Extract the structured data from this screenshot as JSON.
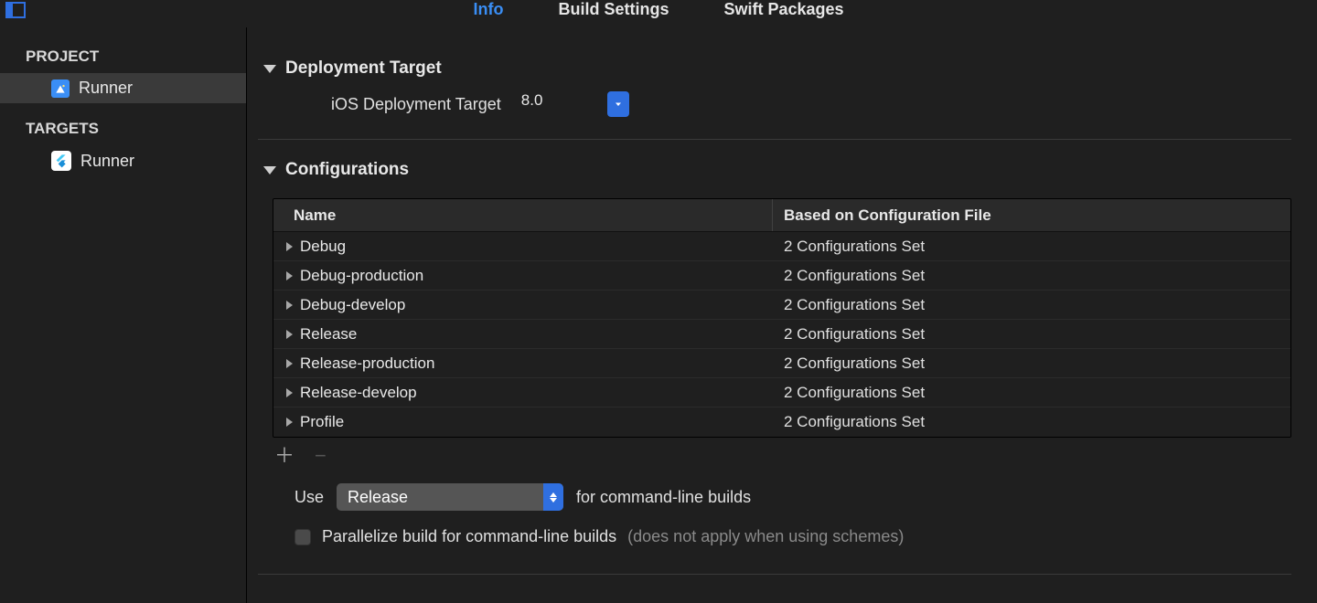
{
  "tabs": {
    "info": "Info",
    "build_settings": "Build Settings",
    "swift_packages": "Swift Packages"
  },
  "sidebar": {
    "project_heading": "PROJECT",
    "project_name": "Runner",
    "targets_heading": "TARGETS",
    "target_name": "Runner"
  },
  "deploy": {
    "section_title": "Deployment Target",
    "field_label": "iOS Deployment Target",
    "value": "8.0"
  },
  "config": {
    "section_title": "Configurations",
    "col_name": "Name",
    "col_file": "Based on Configuration File",
    "rows": [
      {
        "name": "Debug",
        "file": "2 Configurations Set"
      },
      {
        "name": "Debug-production",
        "file": "2 Configurations Set"
      },
      {
        "name": "Debug-develop",
        "file": "2 Configurations Set"
      },
      {
        "name": "Release",
        "file": "2 Configurations Set"
      },
      {
        "name": "Release-production",
        "file": "2 Configurations Set"
      },
      {
        "name": "Release-develop",
        "file": "2 Configurations Set"
      },
      {
        "name": "Profile",
        "file": "2 Configurations Set"
      }
    ],
    "use_prefix": "Use",
    "use_selected": "Release",
    "use_suffix": "for command-line builds",
    "parallel_label": "Parallelize build for command-line builds",
    "parallel_hint": "(does not apply when using schemes)"
  }
}
